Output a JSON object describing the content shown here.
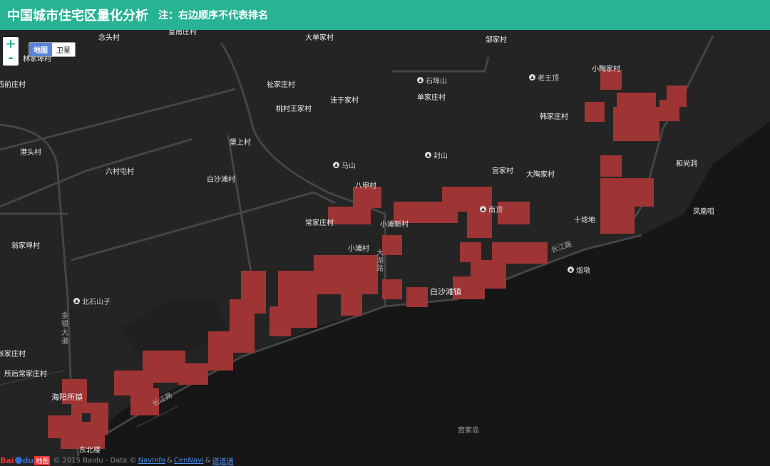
{
  "header": {
    "title": "中国城市住宅区量化分析",
    "note": "注：右边顺序不代表排名"
  },
  "map_controls": {
    "zoom_in": "+",
    "zoom_out": "-",
    "map_type_active": "地图",
    "map_type_inactive": "卫星"
  },
  "labels": {
    "niantoucun": "念头村",
    "huangfuzhuangcun": "皇甫庄村",
    "dadanjiacun": "大单家村",
    "zoujiacun": "邹家村",
    "linjiajicun": "林家埠村",
    "qianzhuangcun": "西前庄村",
    "zhujiazhuangcun": "祉家庄村",
    "taocunwangjiacun": "桃村王家村",
    "wayujiacun": "洼于家村",
    "shanjiazhuangcun": "单家庄村",
    "hanjiazhuangcun": "韩家庄村",
    "xiaotaojiacun": "小陶家村",
    "gangtoucun": "港头村",
    "liucuntuncun": "六村屯村",
    "baoshangcun": "堡上村",
    "baishatancun": "白沙滩村",
    "gongjiacun": "宫家村",
    "datoajiacun": "大陶家村",
    "heshangdong": "和尚洞",
    "bajiacun": "八甲村",
    "changjiazhuangcun": "常家庄村",
    "xiaotanxincun": "小滩新村",
    "shixunzhan": "十埝地",
    "fenghuangju": "凤凰咀",
    "wengjiabucun": "翁家埠村",
    "xiaotancun": "小滩村",
    "dahulu": "大湖路",
    "changjianglu_east": "长江路",
    "baishatanzhen": "白沙滩镇",
    "jinyindadao": "金银大道",
    "zhangjiazhuangcun": "张家庄村",
    "suohouchangjiazhuangcun": "所后常家庄村",
    "haiyangsuozhen": "海阳所镇",
    "changjianglu_west": "长江路",
    "dongbeilou": "东北楼",
    "gongjiadao": "宫家岛"
  },
  "pois": {
    "shibushan": "石埠山",
    "laowangding": "老王顶",
    "mashan": "马山",
    "fengshan": "封山",
    "nanding": "南顶",
    "yandun": "烟墩",
    "beishishanzi": "北石山子"
  },
  "footer": {
    "logo_bai": "Bai",
    "logo_du": "du",
    "logo_ditu": "地图",
    "copyright": "© 2015 Baidu - Data ©",
    "link_navinfo": "NavInfo",
    "amp1": "&",
    "link_cennavi": "CenNavi",
    "amp2": "&",
    "link_daodaotong": "道道通"
  },
  "colors": {
    "header_bg": "#27b394",
    "map_bg": "#1b1b1b",
    "heat_cell": "#9e3434",
    "road": "#4a4a4a",
    "land": "#262626"
  }
}
